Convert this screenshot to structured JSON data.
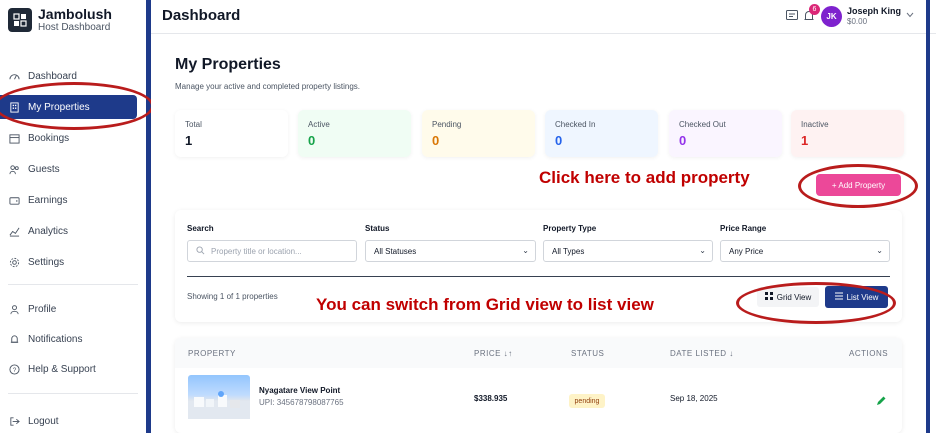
{
  "brand": {
    "name": "Jambolush",
    "subtitle": "Host Dashboard"
  },
  "sidebar": {
    "items": [
      {
        "label": "Dashboard",
        "icon": "gauge-icon"
      },
      {
        "label": "My Properties",
        "icon": "building-icon",
        "active": true
      },
      {
        "label": "Bookings",
        "icon": "calendar-icon"
      },
      {
        "label": "Guests",
        "icon": "users-icon"
      },
      {
        "label": "Earnings",
        "icon": "wallet-icon"
      },
      {
        "label": "Analytics",
        "icon": "chart-line-icon"
      },
      {
        "label": "Settings",
        "icon": "gear-icon"
      }
    ],
    "secondary": [
      {
        "label": "Profile",
        "icon": "user-icon"
      },
      {
        "label": "Notifications",
        "icon": "bell-icon"
      },
      {
        "label": "Help & Support",
        "icon": "help-icon"
      }
    ],
    "logout": "Logout"
  },
  "header": {
    "title": "Dashboard",
    "notification_count": "6",
    "user": {
      "initials": "JK",
      "name": "Joseph King",
      "balance": "$0.00"
    }
  },
  "page": {
    "title": "My Properties",
    "subtitle": "Manage your active and completed property listings."
  },
  "stats": [
    {
      "label": "Total",
      "value": "1",
      "color": "#111827",
      "bg": "#ffffff"
    },
    {
      "label": "Active",
      "value": "0",
      "color": "#16a34a",
      "bg": "#f0fdf4"
    },
    {
      "label": "Pending",
      "value": "0",
      "color": "#d97706",
      "bg": "#fffbeb"
    },
    {
      "label": "Checked In",
      "value": "0",
      "color": "#2563eb",
      "bg": "#eff6ff"
    },
    {
      "label": "Checked Out",
      "value": "0",
      "color": "#9333ea",
      "bg": "#faf5ff"
    },
    {
      "label": "Inactive",
      "value": "1",
      "color": "#dc2626",
      "bg": "#fef2f2"
    }
  ],
  "annotations": {
    "add_property": "Click here to add property",
    "switch_view": "You can switch from Grid view to list view"
  },
  "actions": {
    "add_property": "+ Add Property"
  },
  "filters": {
    "search_label": "Search",
    "search_placeholder": "Property title or location...",
    "status_label": "Status",
    "status_value": "All Statuses",
    "type_label": "Property Type",
    "type_value": "All Types",
    "price_label": "Price Range",
    "price_value": "Any Price"
  },
  "results": {
    "showing": "Showing 1 of 1 properties",
    "grid_view": "Grid View",
    "list_view": "List View"
  },
  "table": {
    "headers": {
      "property": "PROPERTY",
      "price": "PRICE ↓↑",
      "status": "STATUS",
      "date": "DATE LISTED ↓",
      "actions": "ACTIONS"
    },
    "rows": [
      {
        "name": "Nyagatare View Point",
        "upi": "UPI: 345678798087765",
        "price": "$338.935",
        "status": "pending",
        "date": "Sep 18, 2025"
      }
    ]
  }
}
